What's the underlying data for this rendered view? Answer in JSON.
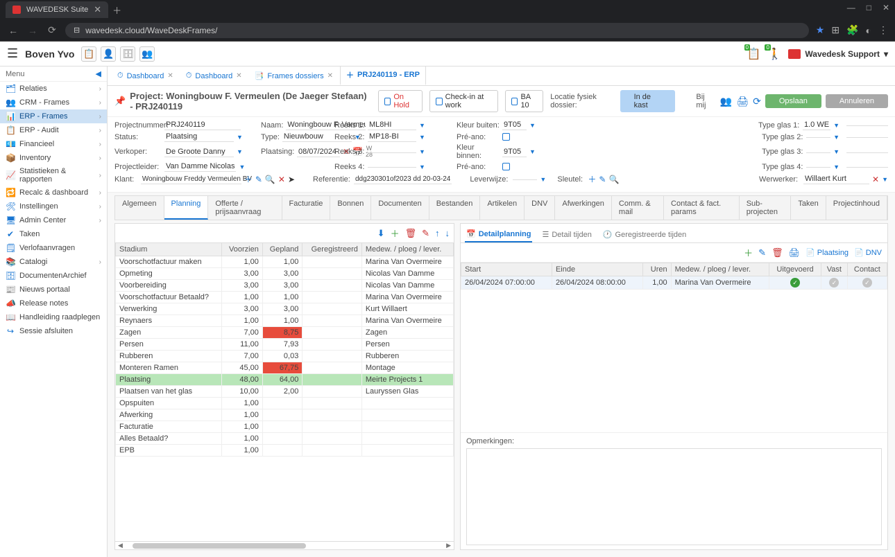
{
  "browser": {
    "tab_title": "WAVEDESK Suite",
    "url": "wavedesk.cloud/WaveDeskFrames/",
    "win_min": "—",
    "win_max": "□",
    "win_close": "✕"
  },
  "header": {
    "username": "Boven Yvo",
    "badge1": "0",
    "badge2": "0",
    "support": "Wavedesk Support"
  },
  "sidebar": {
    "menu_label": "Menu",
    "items": [
      {
        "icon": "🗂",
        "label": "Relaties",
        "exp": true
      },
      {
        "icon": "👥",
        "label": "CRM - Frames",
        "exp": true
      },
      {
        "icon": "📊",
        "label": "ERP - Frames",
        "exp": true,
        "active": true
      },
      {
        "icon": "📋",
        "label": "ERP - Audit",
        "exp": true
      },
      {
        "icon": "💶",
        "label": "Financieel",
        "exp": true
      },
      {
        "icon": "📦",
        "label": "Inventory",
        "exp": true
      },
      {
        "icon": "📈",
        "label": "Statistieken & rapporten",
        "exp": true
      },
      {
        "icon": "🔁",
        "label": "Recalc & dashboard",
        "exp": true
      },
      {
        "icon": "🛠",
        "label": "Instellingen",
        "exp": true
      },
      {
        "icon": "🖥",
        "label": "Admin Center",
        "exp": true
      },
      {
        "icon": "✔",
        "label": "Taken",
        "exp": false
      },
      {
        "icon": "🗒",
        "label": "Verlofaanvragen",
        "exp": false
      },
      {
        "icon": "📚",
        "label": "Catalogi",
        "exp": true
      },
      {
        "icon": "🗄",
        "label": "DocumentenArchief",
        "exp": false
      },
      {
        "icon": "📰",
        "label": "Nieuws portaal",
        "exp": false
      },
      {
        "icon": "📣",
        "label": "Release notes",
        "exp": false
      },
      {
        "icon": "📖",
        "label": "Handleiding raadplegen",
        "exp": false
      },
      {
        "icon": "↪",
        "label": "Sessie afsluiten",
        "exp": false
      }
    ]
  },
  "doc_tabs": [
    {
      "icon": "⏱",
      "label": "Dashboard",
      "close": true
    },
    {
      "icon": "⏱",
      "label": "Dashboard",
      "close": true
    },
    {
      "icon": "📑",
      "label": "Frames dossiers",
      "close": true
    },
    {
      "icon": "＋",
      "label": "PRJ240119 - ERP",
      "close": false,
      "active": true
    }
  ],
  "project": {
    "title": "Project: Woningbouw F. Vermeulen (De Jaeger Stefaan) - PRJ240119",
    "onhold": "On Hold",
    "checkin": "Check-in at work",
    "ba": "BA 10",
    "loc_label": "Locatie fysiek dossier:",
    "loc_value": "In de kast",
    "bijmij": "Bij mij",
    "save": "Opslaan",
    "cancel": "Annuleren"
  },
  "form": {
    "projectnummer_l": "Projectnummer:",
    "projectnummer": "PRJ240119",
    "status_l": "Status:",
    "status": "Plaatsing",
    "verkoper_l": "Verkoper:",
    "verkoper": "De Groote Danny",
    "projectleider_l": "Projectleider:",
    "projectleider": "Van Damme Nicolas",
    "klant_l": "Klant:",
    "klant": "Woningbouw Freddy Vermeulen BV",
    "naam_l": "Naam:",
    "naam": "Woningbouw F. Vermeulen (De Ja",
    "type_l": "Type:",
    "type": "Nieuwbouw",
    "plaatsing_l": "Plaatsing:",
    "plaatsing": "08/07/2024",
    "week": "W 28",
    "referentie_l": "Referentie:",
    "referentie": "ddg230301of2023 dd 20-03-24",
    "reeks1_l": "Reeks 1:",
    "reeks1": "ML8HI",
    "reeks2_l": "Reeks 2:",
    "reeks2": "MP18-BI",
    "reeks3_l": "Reeks 3:",
    "reeks4_l": "Reeks 4:",
    "kleurbuiten_l": "Kleur buiten:",
    "kleurbuiten": "9T05",
    "preano_l": "Pré-ano:",
    "kleurbinnen_l": "Kleur binnen:",
    "kleurbinnen": "9T05",
    "leverwijze_l": "Leverwijze:",
    "sleutel_l": "Sleutel:",
    "typeglas1_l": "Type glas 1:",
    "typeglas1": "1.0 WE",
    "typeglas2_l": "Type glas 2:",
    "typeglas3_l": "Type glas 3:",
    "typeglas4_l": "Type glas 4:",
    "werwerker_l": "Werwerker:",
    "werwerker": "Willaert Kurt"
  },
  "subtabs": [
    "Algemeen",
    "Planning",
    "Offerte / prijsaanvraag",
    "Facturatie",
    "Bonnen",
    "Documenten",
    "Bestanden",
    "Artikelen",
    "DNV",
    "Afwerkingen",
    "Comm. & mail",
    "Contact & fact. params",
    "Sub-projecten",
    "Taken",
    "Projectinhoud"
  ],
  "subtab_active": 1,
  "plan_table": {
    "headers": [
      "Stadium",
      "Voorzien",
      "Gepland",
      "Geregistreerd",
      "Medew. / ploeg / lever."
    ],
    "rows": [
      {
        "s": "Voorschotfactuur maken",
        "v": "1,00",
        "g": "1,00",
        "r": "",
        "m": "Marina Van Overmeire"
      },
      {
        "s": "Opmeting",
        "v": "3,00",
        "g": "3,00",
        "r": "",
        "m": "Nicolas Van Damme"
      },
      {
        "s": "Voorbereiding",
        "v": "3,00",
        "g": "3,00",
        "r": "",
        "m": "Nicolas Van Damme"
      },
      {
        "s": "Voorschotfactuur Betaald?",
        "v": "1,00",
        "g": "1,00",
        "r": "",
        "m": "Marina Van Overmeire"
      },
      {
        "s": "Verwerking",
        "v": "3,00",
        "g": "3,00",
        "r": "",
        "m": "Kurt Willaert"
      },
      {
        "s": "Reynaers",
        "v": "1,00",
        "g": "1,00",
        "r": "",
        "m": "Marina Van Overmeire"
      },
      {
        "s": "Zagen",
        "v": "7,00",
        "g": "8,75",
        "r": "",
        "m": "Zagen",
        "gred": true
      },
      {
        "s": "Persen",
        "v": "11,00",
        "g": "7,93",
        "r": "",
        "m": "Persen"
      },
      {
        "s": "Rubberen",
        "v": "7,00",
        "g": "0,03",
        "r": "",
        "m": "Rubberen"
      },
      {
        "s": "Monteren Ramen",
        "v": "45,00",
        "g": "67,75",
        "r": "",
        "m": "Montage",
        "gred": true
      },
      {
        "s": "Plaatsing",
        "v": "48,00",
        "g": "64,00",
        "r": "",
        "m": "Meirte Projects 1",
        "sel": true,
        "gred": true
      },
      {
        "s": "Plaatsen van het glas",
        "v": "10,00",
        "g": "2,00",
        "r": "",
        "m": "Lauryssen Glas"
      },
      {
        "s": "Opspuiten",
        "v": "1,00",
        "g": "",
        "r": "",
        "m": ""
      },
      {
        "s": "Afwerking",
        "v": "1,00",
        "g": "",
        "r": "",
        "m": ""
      },
      {
        "s": "Facturatie",
        "v": "1,00",
        "g": "",
        "r": "",
        "m": ""
      },
      {
        "s": "Alles Betaald?",
        "v": "1,00",
        "g": "",
        "r": "",
        "m": ""
      },
      {
        "s": "EPB",
        "v": "1,00",
        "g": "",
        "r": "",
        "m": ""
      }
    ]
  },
  "right_tabs": {
    "detail": "Detailplanning",
    "tijden": "Detail tijden",
    "gereg": "Geregistreerde tijden"
  },
  "right_toolbar": {
    "plaatsing": "Plaatsing",
    "dnv": "DNV"
  },
  "detail_table": {
    "headers": [
      "Start",
      "Einde",
      "Uren",
      "Medew. / ploeg / lever.",
      "Uitgevoerd",
      "Vast",
      "Contact"
    ],
    "rows": [
      {
        "start": "26/04/2024 07:00:00",
        "einde": "26/04/2024 08:00:00",
        "uren": "1,00",
        "medew": "Marina Van Overmeire",
        "uit": "green",
        "vast": "gray",
        "contact": "gray"
      }
    ]
  },
  "opm_label": "Opmerkingen:"
}
